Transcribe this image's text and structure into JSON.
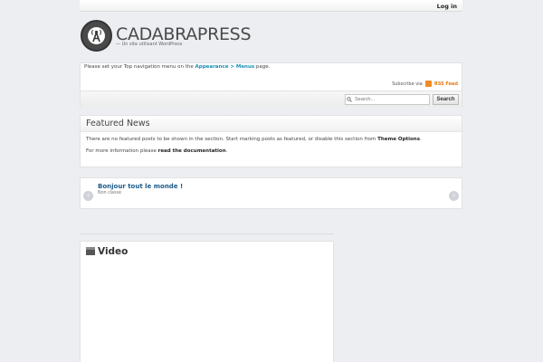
{
  "topbar": {
    "login_label": "Log in"
  },
  "header": {
    "title": "CADABRAPRESS",
    "description": "— Un site utilisant WordPress"
  },
  "nav": {
    "message_prefix": "Please set your Top navigation menu on the ",
    "message_link": "Appearance > Menus",
    "message_suffix": " page.",
    "subscribe_label": "Subscribe via",
    "rss_label": "RSS Feed"
  },
  "search": {
    "placeholder": "Search...",
    "button_label": "Search"
  },
  "featured": {
    "title": "Featured News",
    "message": "There are no featured posts to be shown in the section. Start marking posts as featured, or disable this section from ",
    "message_link": "Theme Options",
    "message_end": ".",
    "info_prefix": "For more information please ",
    "info_link": "read the documentation",
    "info_end": "."
  },
  "slider": {
    "post_title": "Bonjour tout le monde !",
    "post_category": "Non classé",
    "prev_icon": "chevron-left-icon",
    "next_icon": "chevron-right-icon"
  },
  "video": {
    "title": "Video"
  },
  "colors": {
    "link": "#1a8fb4",
    "rss": "#f08a24",
    "background": "#eceef1"
  }
}
